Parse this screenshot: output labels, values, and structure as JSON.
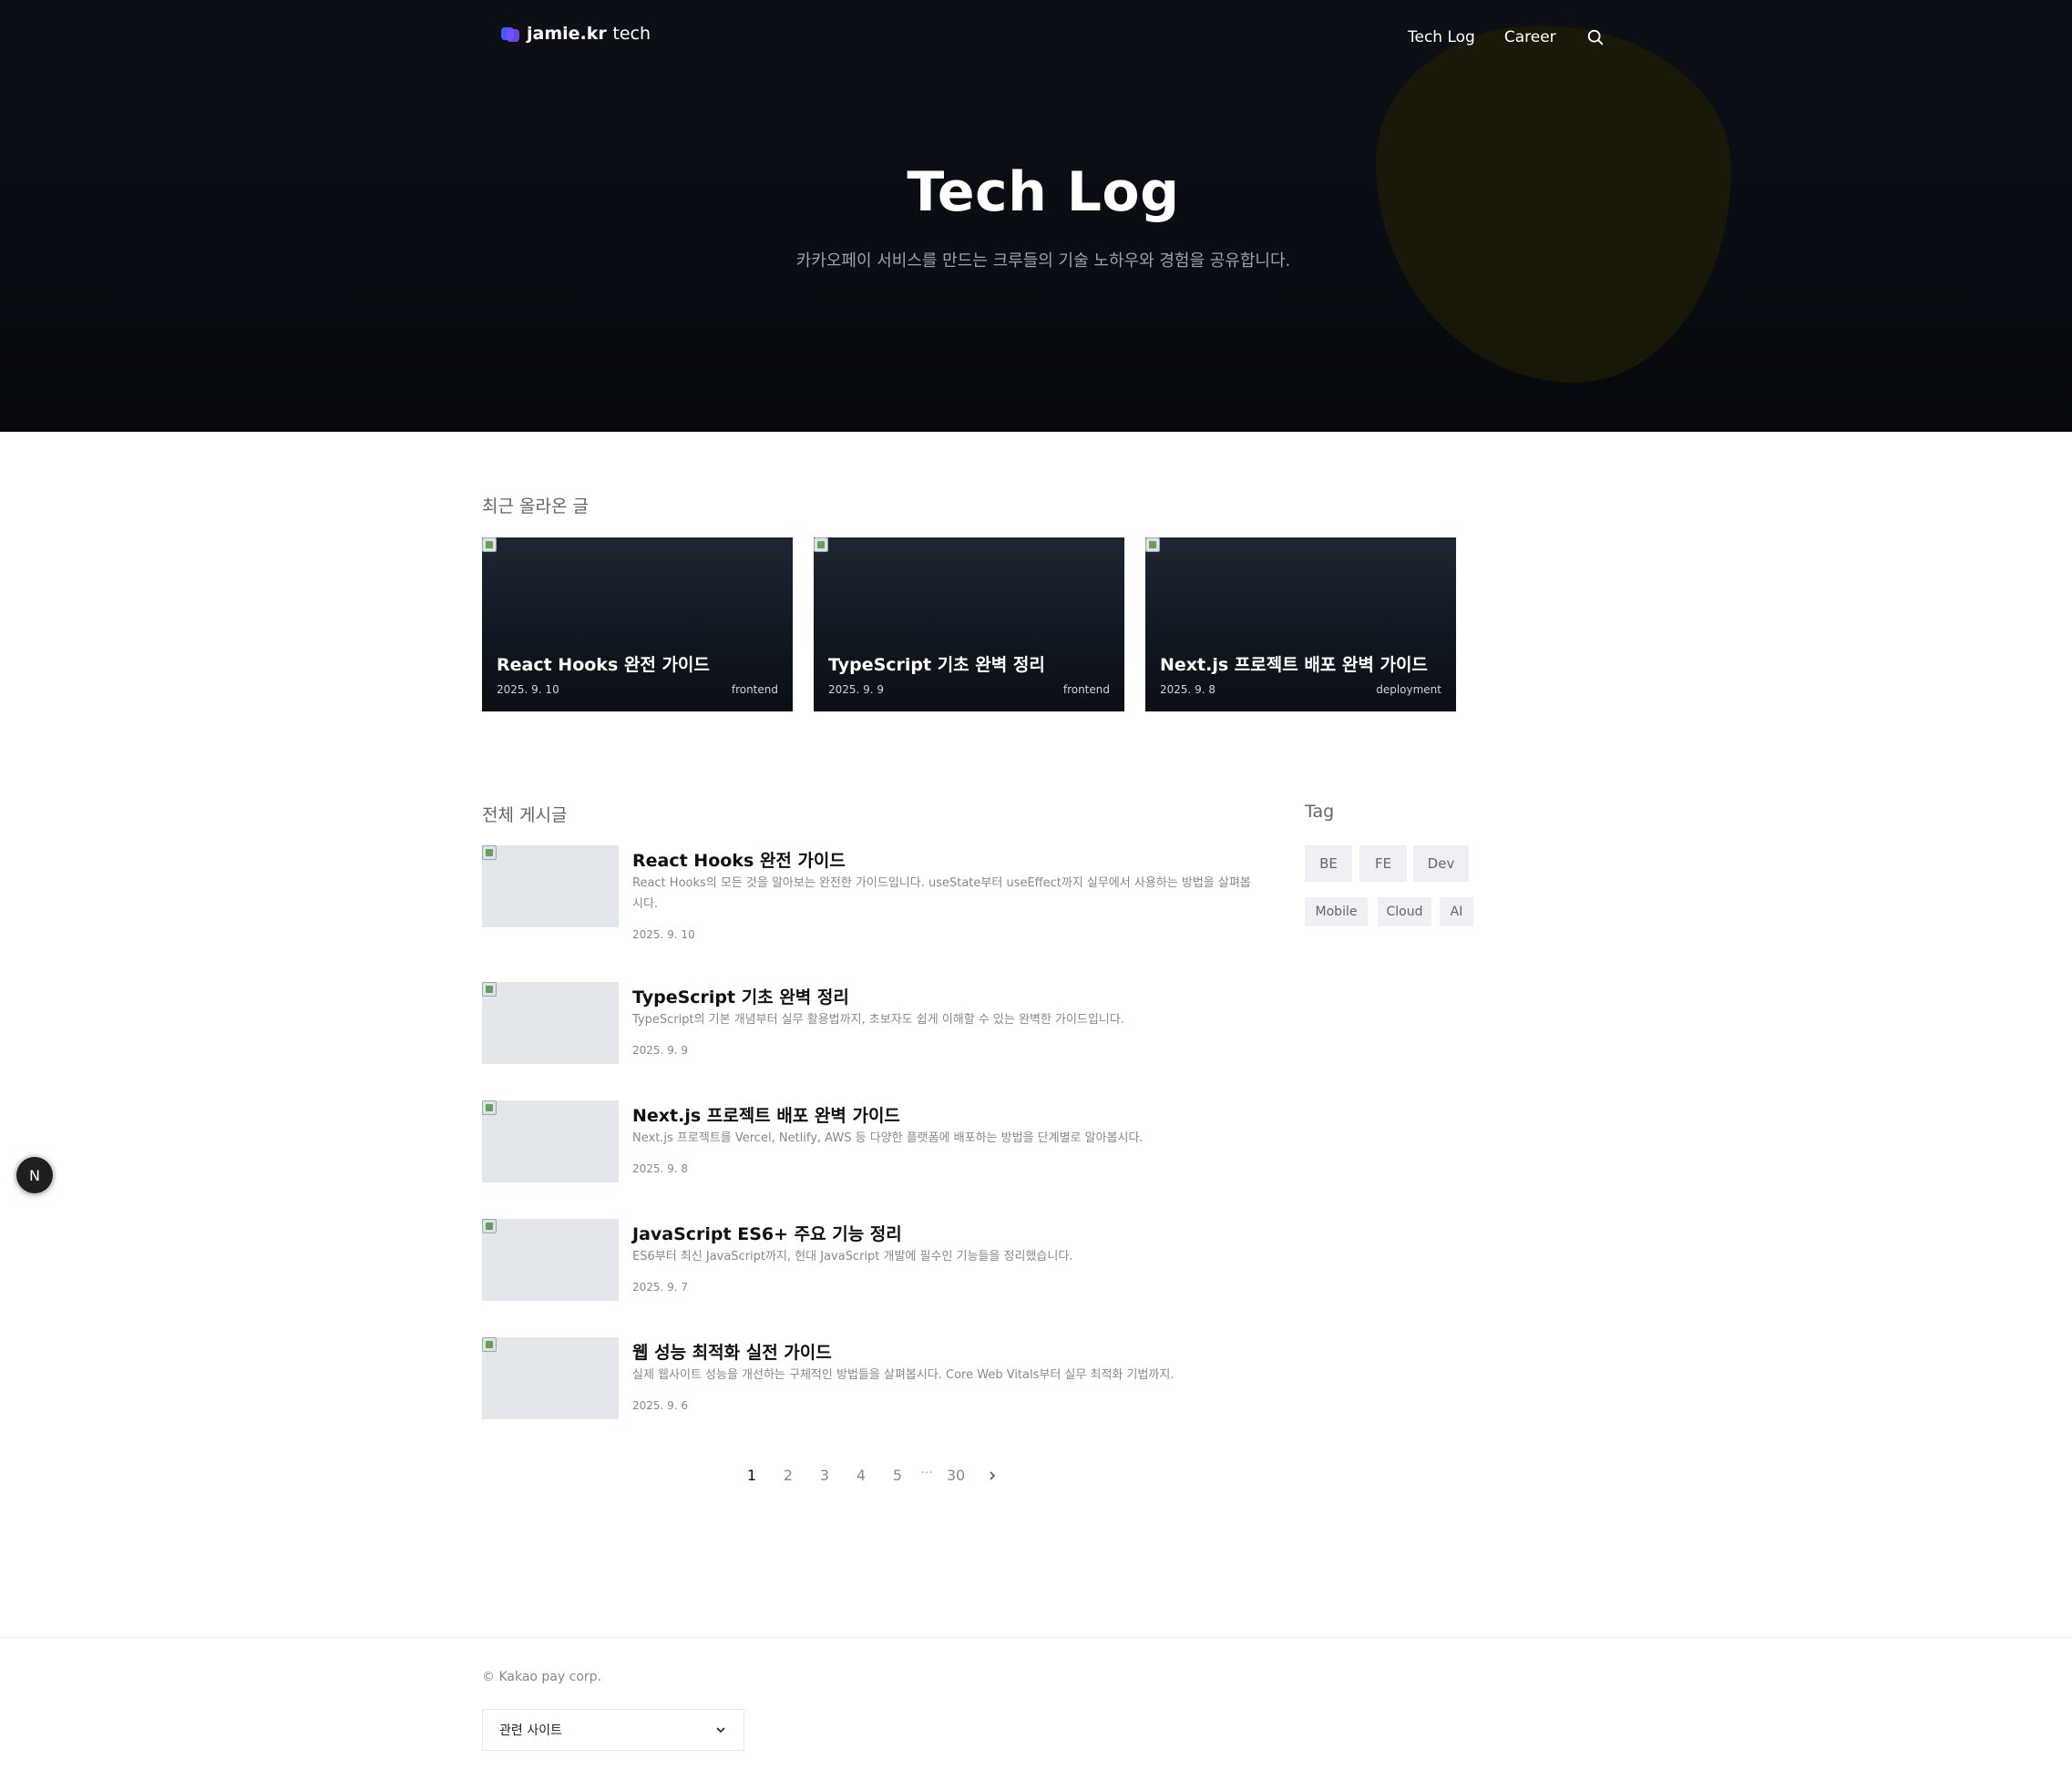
{
  "header": {
    "logo_bold": "jamie.kr",
    "logo_light": "tech",
    "nav": [
      "Tech Log",
      "Career"
    ]
  },
  "hero": {
    "title": "Tech Log",
    "subtitle": "카카오페이 서비스를 만드는 크루들의 기술 노하우와 경험을 공유합니다."
  },
  "recent": {
    "title": "최근 올라온 글",
    "cards": [
      {
        "title": "React Hooks 완전 가이드",
        "date": "2025. 9. 10",
        "tag": "frontend"
      },
      {
        "title": "TypeScript 기초 완벽 정리",
        "date": "2025. 9. 9",
        "tag": "frontend"
      },
      {
        "title": "Next.js 프로젝트 배포 완벽 가이드",
        "date": "2025. 9. 8",
        "tag": "deployment"
      }
    ]
  },
  "posts": {
    "title": "전체 게시글",
    "items": [
      {
        "title": "React Hooks 완전 가이드",
        "desc": "React Hooks의 모든 것을 알아보는 완전한 가이드입니다. useState부터 useEffect까지 실무에서 사용하는 방법을 살펴봅시다.",
        "date": "2025. 9. 10"
      },
      {
        "title": "TypeScript 기초 완벽 정리",
        "desc": "TypeScript의 기본 개념부터 실무 활용법까지, 초보자도 쉽게 이해할 수 있는 완벽한 가이드입니다.",
        "date": "2025. 9. 9"
      },
      {
        "title": "Next.js 프로젝트 배포 완벽 가이드",
        "desc": "Next.js 프로젝트를 Vercel, Netlify, AWS 등 다양한 플랫폼에 배포하는 방법을 단계별로 알아봅시다.",
        "date": "2025. 9. 8"
      },
      {
        "title": "JavaScript ES6+ 주요 기능 정리",
        "desc": "ES6부터 최신 JavaScript까지, 현대 JavaScript 개발에 필수인 기능들을 정리했습니다.",
        "date": "2025. 9. 7"
      },
      {
        "title": "웹 성능 최적화 실전 가이드",
        "desc": "실제 웹사이트 성능을 개선하는 구체적인 방법들을 살펴봅시다. Core Web Vitals부터 실무 최적화 기법까지.",
        "date": "2025. 9. 6"
      }
    ]
  },
  "tags": {
    "title": "Tag",
    "items": [
      "BE",
      "FE",
      "Dev",
      "Mobile",
      "Cloud",
      "AI"
    ]
  },
  "pagination": {
    "pages": [
      "1",
      "2",
      "3",
      "4",
      "5"
    ],
    "ellipsis": "···",
    "last": "30",
    "current": "1"
  },
  "footer": {
    "copyright": "© Kakao pay corp.",
    "related_label": "관련 사이트"
  },
  "floating_badge": "N",
  "colors": {
    "hero_bg": "#0a0e14",
    "blob": "#1c1a08",
    "tag_bg": "#eef0f3"
  }
}
